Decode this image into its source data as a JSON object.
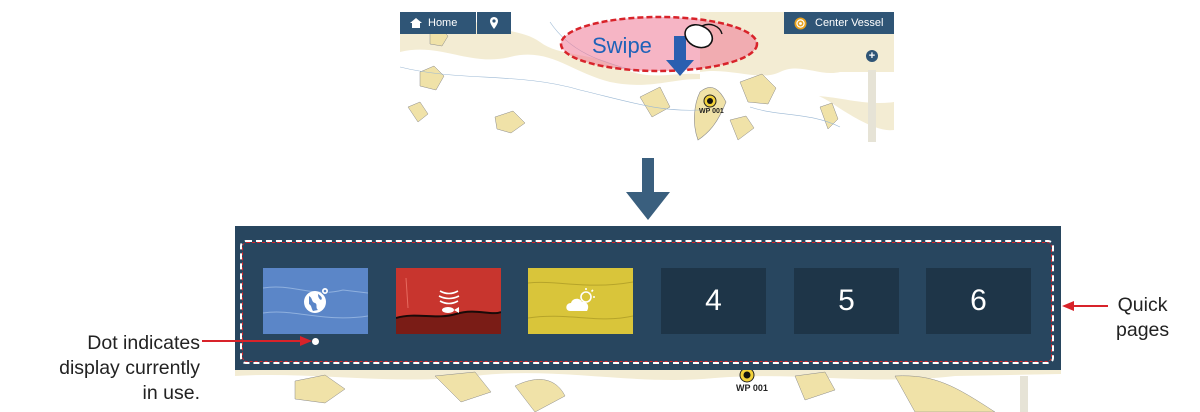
{
  "top_chart": {
    "home_label": "Home",
    "center_label": "Center Vessel",
    "zoom_plus": "+",
    "waypoint_label": "WP 001"
  },
  "swipe_label": "Swipe",
  "quick_pages": {
    "tiles": [
      {
        "kind": "plotter",
        "icon": "globe-icon",
        "color": "#5b86c8"
      },
      {
        "kind": "fish-finder",
        "icon": "fish-finder-icon",
        "color": "#c8352e"
      },
      {
        "kind": "weather",
        "icon": "weather-icon",
        "color": "#d9c53a"
      },
      {
        "kind": "number",
        "label": "4"
      },
      {
        "kind": "number",
        "label": "5"
      },
      {
        "kind": "number",
        "label": "6"
      }
    ],
    "waypoint_label": "WP 001"
  },
  "callouts": {
    "dot_line1": "Dot indicates",
    "dot_line2": "display currently",
    "dot_line3": "in use.",
    "quick_line1": "Quick",
    "quick_line2": "pages"
  },
  "colors": {
    "panel": "#28465f",
    "toolbar": "#2f5576",
    "highlight": "#d8232a",
    "arrow": "#2f5576"
  }
}
